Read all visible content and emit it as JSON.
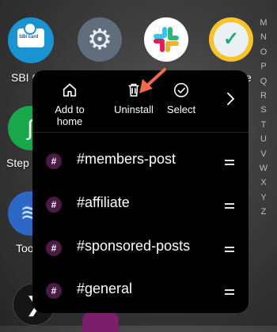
{
  "home": {
    "labels": {
      "sbi": "SBI C",
      "clock_partial": "e",
      "step": "Step",
      "too": "Too"
    },
    "sbi_card_text": "SBI card",
    "alphabet": [
      "M",
      "N",
      "O",
      "P",
      "Q",
      "R",
      "S",
      "T",
      "U",
      "V",
      "W",
      "X",
      "Y",
      "Z"
    ]
  },
  "popup": {
    "actions": [
      {
        "label": "Add to home",
        "line1": "Add to",
        "line2": "home",
        "icon": "home-icon"
      },
      {
        "label": "Uninstall",
        "icon": "trash-icon"
      },
      {
        "label": "Select",
        "icon": "check-circle-icon"
      },
      {
        "icon": "chevron-right-icon"
      }
    ],
    "shortcuts": [
      {
        "name": "#members-post",
        "icon": "#"
      },
      {
        "name": "#affiliate",
        "icon": "#"
      },
      {
        "name": "#sponsored-posts",
        "icon": "#"
      },
      {
        "name": "#general",
        "icon": "#"
      }
    ]
  },
  "colors": {
    "popup_bg": "#000000",
    "hash_badge": "#4a1b45",
    "annotation_arrow": "#f26a4b",
    "sbi_blue": "#1a93d2",
    "settings_gray": "#5f6d7c",
    "clock_yellow": "#f6c42a"
  }
}
